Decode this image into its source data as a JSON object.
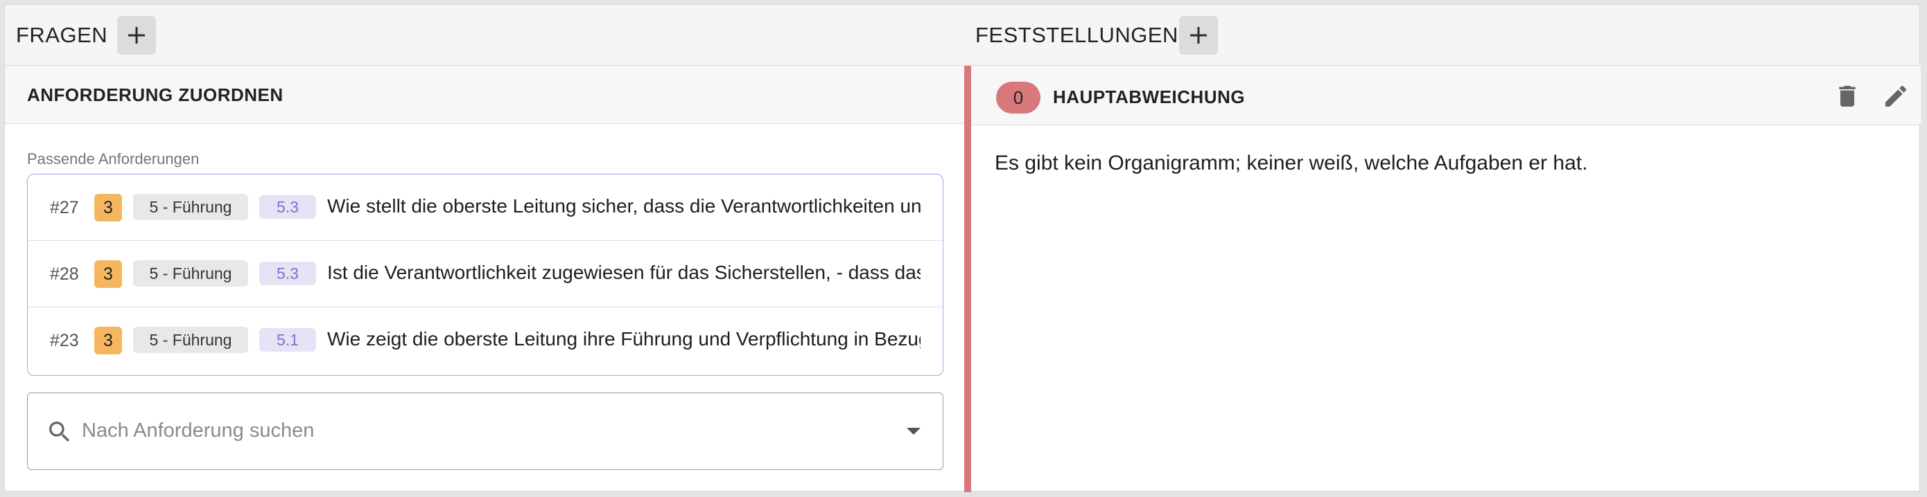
{
  "questions": {
    "label": "FRAGEN"
  },
  "findings": {
    "label": "FESTSTELLUNGEN"
  },
  "assign_panel": {
    "title": "ANFORDERUNG ZUORDNEN",
    "matching_label": "Passende Anforderungen",
    "requirements": [
      {
        "id": "#27",
        "level": "3",
        "category": "5 - Führung",
        "clause": "5.3",
        "text": "Wie stellt die oberste Leitung sicher, dass die Verantwortlichkeiten und Befugnisse für relevante Rollen zugewiesen werden?"
      },
      {
        "id": "#28",
        "level": "3",
        "category": "5 - Führung",
        "clause": "5.3",
        "text": "Ist die Verantwortlichkeit zugewiesen für das Sicherstellen, - dass das Managementsystem den Anforderungen entspricht?"
      },
      {
        "id": "#23",
        "level": "3",
        "category": "5 - Führung",
        "clause": "5.1",
        "text": "Wie zeigt die oberste Leitung ihre Führung und Verpflichtung in Bezug auf das Managementsystem?"
      }
    ],
    "search": {
      "placeholder": "Nach Anforderung suchen",
      "value": ""
    }
  },
  "finding": {
    "count": "0",
    "title": "HAUPTABWEICHUNG",
    "text": "Es gibt kein Organigramm; keiner weiß, welche Aufgaben er hat."
  },
  "colors": {
    "accent_red": "#d9787a",
    "level_orange": "#f6b65f",
    "clause_purple": "#7b74c8",
    "list_border": "#a9a2e4"
  },
  "icons": [
    "plus-icon",
    "search-icon",
    "arrow-drop-down-icon",
    "delete-icon",
    "edit-icon"
  ]
}
